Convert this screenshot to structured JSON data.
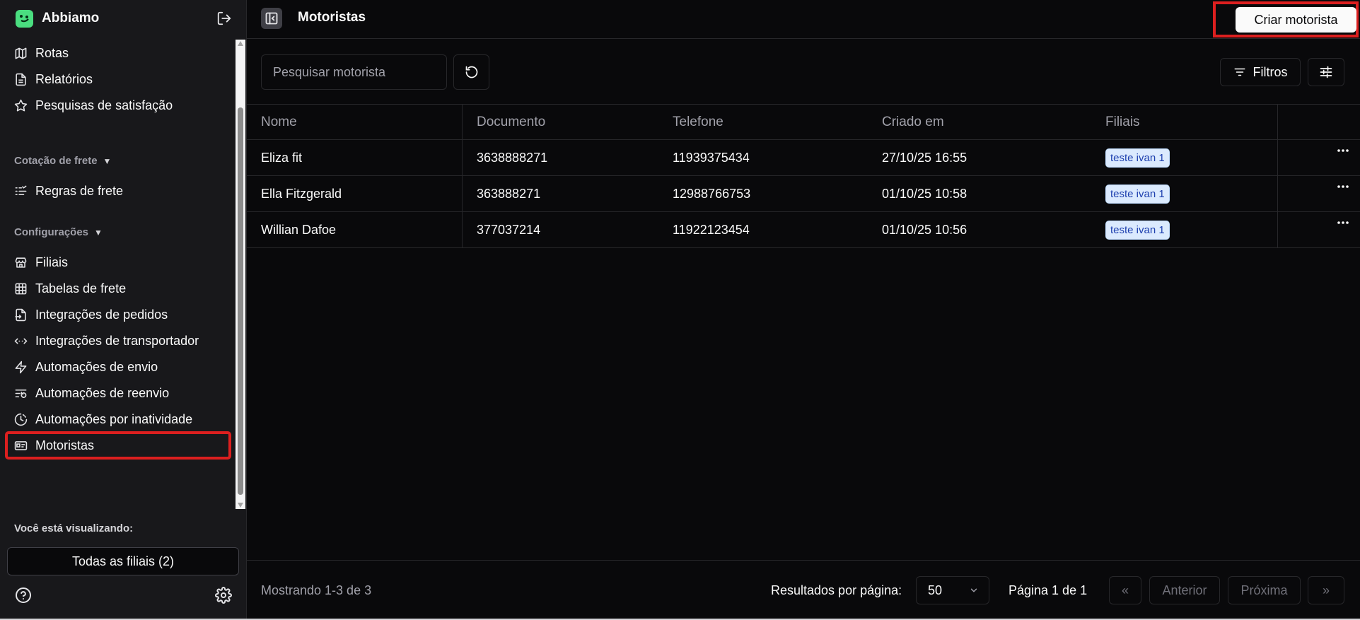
{
  "sidebar": {
    "brand": "Abbiamo",
    "items_top": [
      {
        "label": "Rotas",
        "icon": "map-icon"
      },
      {
        "label": "Relatórios",
        "icon": "file-text-icon"
      },
      {
        "label": "Pesquisas de satisfação",
        "icon": "star-icon"
      }
    ],
    "section_freight": "Cotação de frete",
    "items_freight": [
      {
        "label": "Regras de frete",
        "icon": "list-rules-icon"
      }
    ],
    "section_config": "Configurações",
    "items_config": [
      {
        "label": "Filiais",
        "icon": "store-icon"
      },
      {
        "label": "Tabelas de frete",
        "icon": "table-icon"
      },
      {
        "label": "Integrações de pedidos",
        "icon": "file-import-icon"
      },
      {
        "label": "Integrações de transportador",
        "icon": "code-arrows-icon"
      },
      {
        "label": "Automações de envio",
        "icon": "zap-icon"
      },
      {
        "label": "Automações de reenvio",
        "icon": "list-restart-icon"
      },
      {
        "label": "Automações por inatividade",
        "icon": "clock-icon"
      },
      {
        "label": "Motoristas",
        "icon": "id-card-icon"
      }
    ],
    "viewing_label": "Você está visualizando:",
    "branch_selector": "Todas as filiais (2)"
  },
  "header": {
    "title": "Motoristas",
    "create_button": "Criar motorista"
  },
  "toolbar": {
    "search_placeholder": "Pesquisar motorista",
    "filters_label": "Filtros"
  },
  "table": {
    "columns": [
      "Nome",
      "Documento",
      "Telefone",
      "Criado em",
      "Filiais"
    ],
    "rows": [
      {
        "name": "Eliza fit",
        "document": "3638888271",
        "phone": "11939375434",
        "created": "27/10/25 16:55",
        "branch": "teste ivan 1"
      },
      {
        "name": "Ella Fitzgerald",
        "document": "363888271",
        "phone": "12988766753",
        "created": "01/10/25 10:58",
        "branch": "teste ivan 1"
      },
      {
        "name": "Willian Dafoe",
        "document": "377037214",
        "phone": "11922123454",
        "created": "01/10/25 10:56",
        "branch": "teste ivan 1"
      }
    ]
  },
  "footer": {
    "showing": "Mostrando 1-3 de 3",
    "per_page_label": "Resultados por página:",
    "per_page_value": "50",
    "page_label": "Página 1 de 1",
    "first": "«",
    "prev": "Anterior",
    "next": "Próxima",
    "last": "»"
  },
  "colors": {
    "background": "#09090b",
    "sidebar": "#18181b",
    "brand": "#4ade80",
    "highlight": "#dc1f1f",
    "badge_bg": "#dbeafe",
    "badge_text": "#1e40af"
  }
}
